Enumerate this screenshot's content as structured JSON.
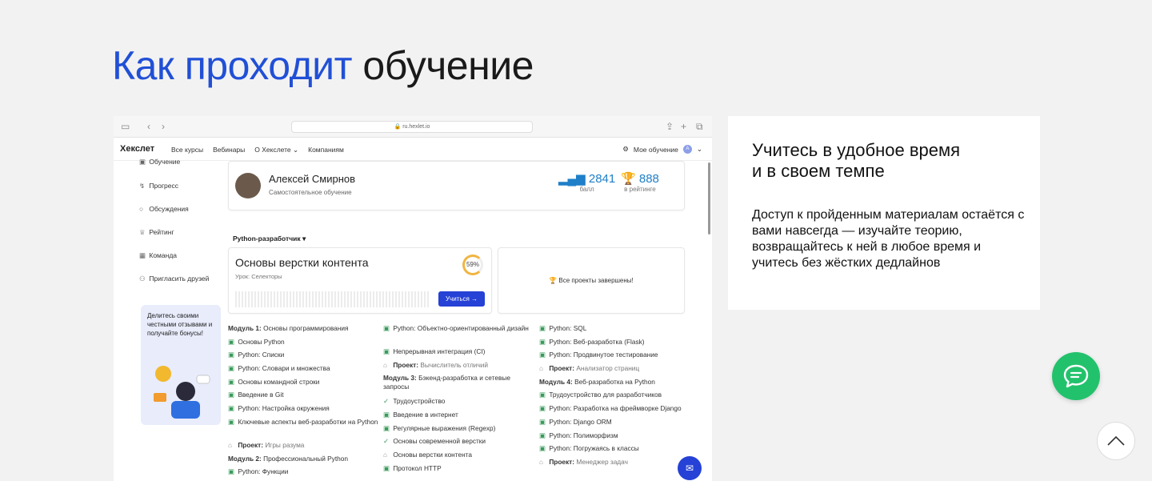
{
  "heading": {
    "accent": "Как проходит",
    "rest": "обучение"
  },
  "browser": {
    "url": "ru.hexlet.io"
  },
  "site_nav": {
    "logo": "Хекслет",
    "links": [
      "Все курсы",
      "Вебинары",
      "О Хекслете",
      "Компаниям"
    ],
    "my_learning": "Мое обучение",
    "avatar_letter": "A"
  },
  "sidebar": [
    {
      "icon": "book-icon",
      "label": "Обучение"
    },
    {
      "icon": "progress-icon",
      "label": "Прогресс"
    },
    {
      "icon": "chat-icon",
      "label": "Обсуждения"
    },
    {
      "icon": "trophy-icon",
      "label": "Рейтинг"
    },
    {
      "icon": "team-icon",
      "label": "Команда"
    },
    {
      "icon": "invite-icon",
      "label": "Пригласить друзей"
    }
  ],
  "promo": "Делитесь своими честными отзывами и получайте бонусы!",
  "user": {
    "name": "Алексей Смирнов",
    "mode": "Самостоятельное обучение",
    "score": "2841",
    "score_label": "балл",
    "rank": "888",
    "rank_label": "в рейтинге"
  },
  "track": "Python-разработчик",
  "course": {
    "title": "Основы верстки контента",
    "lesson": "Урок: Селекторы",
    "progress": "59%",
    "button": "Учиться →"
  },
  "projects_done": "Все проекты завершены!",
  "columns": [
    [
      {
        "type": "module",
        "bold": "Модуль 1:",
        "text": "Основы программирования"
      },
      {
        "type": "done",
        "text": "Основы Python"
      },
      {
        "type": "done",
        "text": "Python: Списки"
      },
      {
        "type": "done",
        "text": "Python: Словари и множества"
      },
      {
        "type": "done",
        "text": "Основы командной строки"
      },
      {
        "type": "done",
        "text": "Введение в Git"
      },
      {
        "type": "done",
        "text": "Python: Настройка окружения"
      },
      {
        "type": "done-wrap",
        "text": "Ключевые аспекты веб-разработки на Python"
      },
      {
        "type": "project",
        "bold": "Проект:",
        "text": "Игры разума"
      },
      {
        "type": "module",
        "bold": "Модуль 2:",
        "text": "Профессиональный Python"
      },
      {
        "type": "done",
        "text": "Python: Функции"
      }
    ],
    [
      {
        "type": "done-wrap",
        "text": "Python: Объектно-ориентированный дизайн"
      },
      {
        "type": "done",
        "text": "Непрерывная интеграция (CI)"
      },
      {
        "type": "project",
        "bold": "Проект:",
        "text": "Вычислитель отличий"
      },
      {
        "type": "module-wrap",
        "bold": "Модуль 3:",
        "text": "Бэкенд-разработка и сетевые запросы"
      },
      {
        "type": "check",
        "text": "Трудоустройство"
      },
      {
        "type": "done",
        "text": "Введение в интернет"
      },
      {
        "type": "done",
        "text": "Регулярные выражения (Regexp)"
      },
      {
        "type": "check",
        "text": "Основы современной верстки"
      },
      {
        "type": "lock",
        "text": "Основы верстки контента"
      },
      {
        "type": "done",
        "text": "Протокол HTTP"
      }
    ],
    [
      {
        "type": "done",
        "text": "Python: SQL"
      },
      {
        "type": "done",
        "text": "Python: Веб-разработка (Flask)"
      },
      {
        "type": "done",
        "text": "Python: Продвинутое тестирование"
      },
      {
        "type": "project",
        "bold": "Проект:",
        "text": "Анализатор страниц"
      },
      {
        "type": "module",
        "bold": "Модуль 4:",
        "text": "Веб-разработка на Python"
      },
      {
        "type": "done",
        "text": "Трудоустройство для разработчиков"
      },
      {
        "type": "done",
        "text": "Python: Разработка на фреймворке Django"
      },
      {
        "type": "done",
        "text": "Python: Django ORM"
      },
      {
        "type": "done",
        "text": "Python: Полиморфизм"
      },
      {
        "type": "done",
        "text": "Python: Погружаясь в классы"
      },
      {
        "type": "project",
        "bold": "Проект:",
        "text": "Менеджер задач"
      }
    ]
  ],
  "info": {
    "title": "Учитесь в удобное время\nи в своем темпе",
    "text": "Доступ к пройденным материалам остаётся с вами навсегда — изучайте теорию, возвращайтесь к ней в любое время и учитесь без жёстких дедлайнов"
  }
}
